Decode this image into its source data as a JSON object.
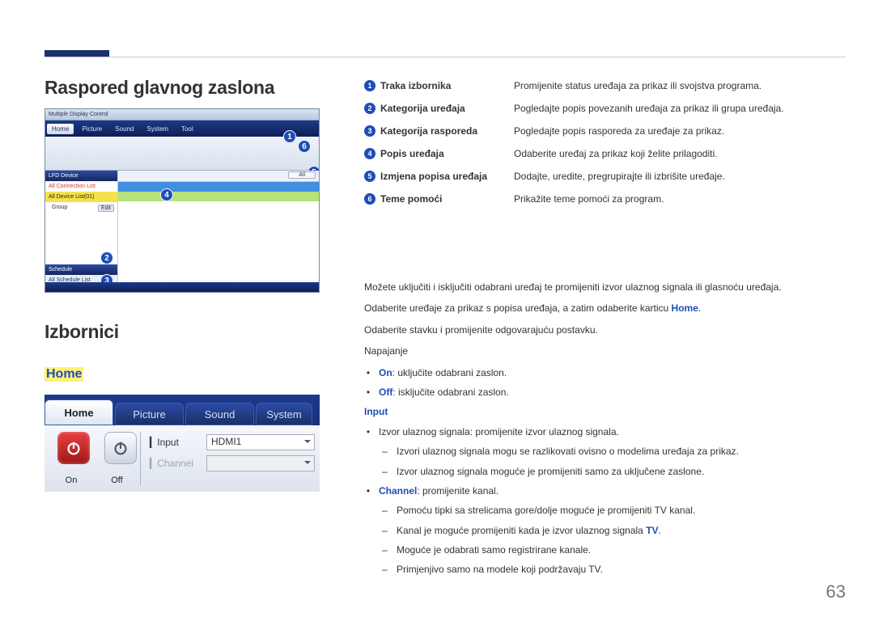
{
  "page": {
    "number": "63"
  },
  "h1": "Raspored glavnog zaslona",
  "h2": "Izbornici",
  "home_label": "Home",
  "shot1": {
    "title": "Multiple Display Control",
    "tabs": {
      "home": "Home",
      "picture": "Picture",
      "sound": "Sound",
      "system": "System",
      "tool": "Tool"
    },
    "left_panel": {
      "lfd_device": "LFD Device",
      "all_conn": "All Connection List",
      "all_device": "All Device List(01)",
      "group": "Group",
      "edit": "Edit",
      "schedule": "Schedule",
      "all_sched": "All Schedule List"
    },
    "filter_all": "All"
  },
  "legend": [
    {
      "n": "1",
      "title": "Traka izbornika",
      "desc": "Promijenite status uređaja za prikaz ili svojstva programa."
    },
    {
      "n": "2",
      "title": "Kategorija uređaja",
      "desc": "Pogledajte popis povezanih uređaja za prikaz ili grupa uređaja."
    },
    {
      "n": "3",
      "title": "Kategorija rasporeda",
      "desc": "Pogledajte popis rasporeda za uređaje za prikaz."
    },
    {
      "n": "4",
      "title": "Popis uređaja",
      "desc": "Odaberite uređaj za prikaz koji želite prilagoditi."
    },
    {
      "n": "5",
      "title": "Izmjena popisa uređaja",
      "desc": "Dodajte, uredite, pregrupirajte ili izbrišite uređaje."
    },
    {
      "n": "6",
      "title": "Teme pomoći",
      "desc": "Prikažite teme pomoći za program."
    }
  ],
  "shot2": {
    "tabs": {
      "home": "Home",
      "picture": "Picture",
      "sound": "Sound",
      "system": "System"
    },
    "on": "On",
    "off": "Off",
    "input_label": "Input",
    "input_value": "HDMI1",
    "channel_label": "Channel"
  },
  "rtext": {
    "p1": "Možete uključiti i isključiti odabrani uređaj te promijeniti izvor ulaznog signala ili glasnoću uređaja.",
    "p2_a": "Odaberite uređaje za prikaz s popisa uređaja, a zatim odaberite karticu ",
    "p2_home": "Home",
    "p2_b": ".",
    "p3": "Odaberite stavku i promijenite odgovarajuću postavku.",
    "napajanje": "Napajanje",
    "on_label": "On",
    "on_desc": ": uključite odabrani zaslon.",
    "off_label": "Off",
    "off_desc": ": isključite odabrani zaslon.",
    "input_h": "Input",
    "b_input": "Izvor ulaznog signala: promijenite izvor ulaznog signala.",
    "b_input_s1": "Izvori ulaznog signala mogu se razlikovati ovisno o modelima uređaja za prikaz.",
    "b_input_s2": "Izvor ulaznog signala moguće je promijeniti samo za uključene zaslone.",
    "channel_label": "Channel",
    "channel_desc": ": promijenite kanal.",
    "ch_s1": "Pomoću tipki sa strelicama gore/dolje moguće je promijeniti TV kanal.",
    "ch_s2_a": "Kanal je moguće promijeniti kada je izvor ulaznog signala ",
    "ch_s2_tv": "TV",
    "ch_s2_b": ".",
    "ch_s3": "Moguće je odabrati samo registrirane kanale.",
    "ch_s4": "Primjenjivo samo na modele koji podržavaju TV."
  }
}
